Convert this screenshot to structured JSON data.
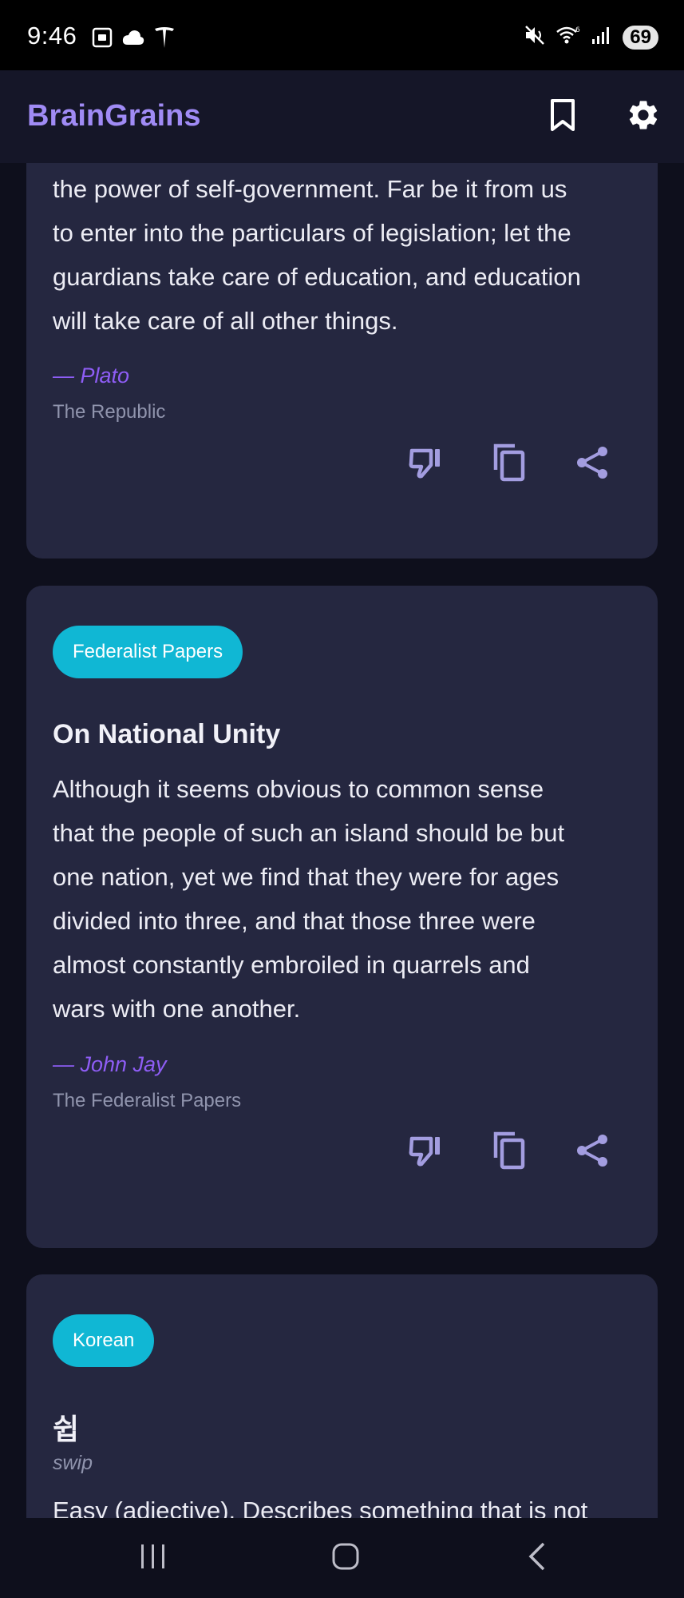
{
  "status_bar": {
    "time": "9:46",
    "battery": "69"
  },
  "app_bar": {
    "title": "BrainGrains"
  },
  "cards": [
    {
      "lines": [
        "the power of self-government. Far be it from us",
        "to enter into the particulars of legislation; let the",
        "guardians take care of education, and education",
        "will take care of all other things."
      ],
      "author": "— Plato",
      "source": "The Republic"
    },
    {
      "tag": "Federalist Papers",
      "title": "On National Unity",
      "lines": [
        "Although it seems obvious to common sense",
        "that the people of such an island should be but",
        "one nation, yet we find that they were for ages",
        "divided into three, and that those three were",
        "almost constantly embroiled in quarrels and",
        "wars with one another."
      ],
      "author": "— John Jay",
      "source": "The Federalist Papers"
    },
    {
      "tag": "Korean",
      "word": "쉽",
      "romanization": "swip",
      "definition": "Easy (adjective). Describes something that is not"
    }
  ],
  "icons": {
    "bookmark": "bookmark-icon",
    "settings": "gear-icon",
    "dislike": "thumbs-down-icon",
    "copy": "copy-icon",
    "share": "share-icon"
  },
  "colors": {
    "accent": "#a08bf5",
    "author": "#8e5df5",
    "chip": "#10b7d4",
    "card": "#252740",
    "background": "#0e0f1c"
  }
}
